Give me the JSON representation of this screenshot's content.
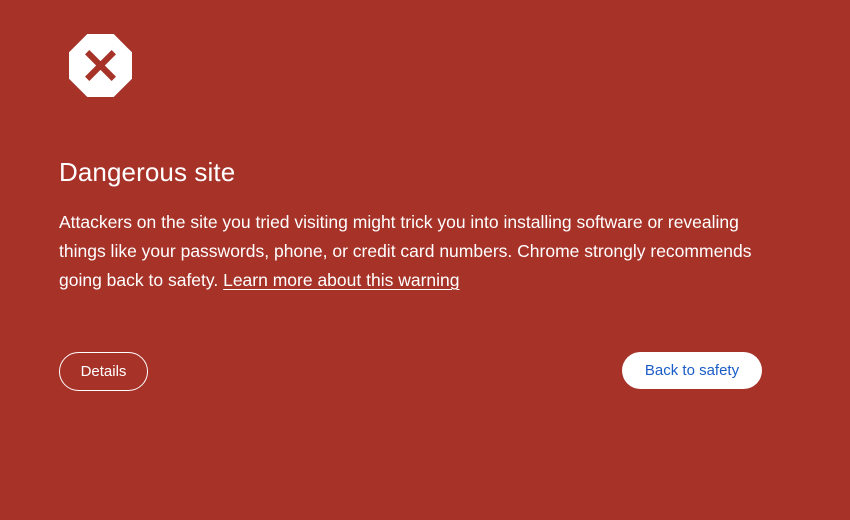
{
  "interstitial": {
    "icon": "dangerous-site-icon",
    "title": "Dangerous site",
    "message": "Attackers on the site you tried visiting might trick you into installing software or revealing things like your passwords, phone, or credit card numbers. Chrome strongly recommends going back to safety.",
    "learn_more_label": "Learn more about this warning",
    "details_label": "Details",
    "back_to_safety_label": "Back to safety"
  },
  "colors": {
    "background": "#a63228",
    "text": "#ffffff",
    "primary_button_bg": "#ffffff",
    "primary_button_text": "#1a5cc8",
    "icon_fill": "#ffffff",
    "icon_mark": "#a63228"
  }
}
